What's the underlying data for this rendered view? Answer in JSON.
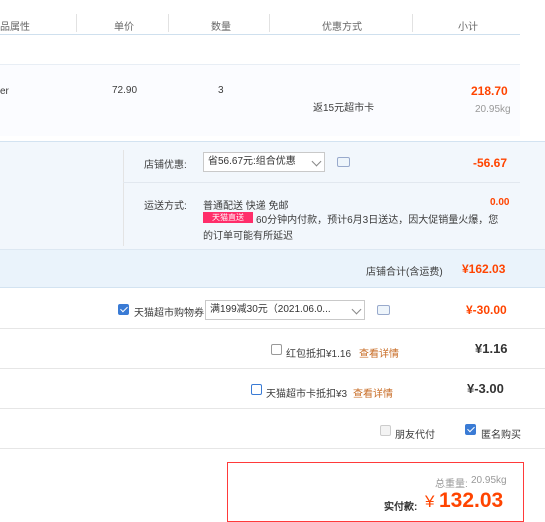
{
  "columns": {
    "attr": "品属性",
    "price": "单价",
    "qty": "数量",
    "discount": "优惠方式",
    "subtotal": "小计"
  },
  "item": {
    "attr_fragment": "er",
    "price": "72.90",
    "qty": "3",
    "discount_note": "返15元超市卡",
    "subtotal": "218.70",
    "weight": "20.95kg"
  },
  "store_discount": {
    "label": "店铺优惠:",
    "selected": "省56.67元:组合优惠",
    "amount": "-56.67"
  },
  "shipping": {
    "label": "运送方式:",
    "method": "普通配送 快递 免邮",
    "amount": "0.00",
    "tag": "天猫直送",
    "note_line1": "60分钟内付款，预计6月3日送达，因大促销量火爆，您",
    "note_line2": "的订单可能有所延迟"
  },
  "store_total": {
    "label": "店铺合计(含运费)",
    "amount": "¥162.03"
  },
  "coupon": {
    "label": "天猫超市购物券",
    "selected": "满199减30元（2021.06.0...",
    "amount": "¥-30.00"
  },
  "hongbao": {
    "label": "红包抵扣¥1.16",
    "link": "查看详情",
    "amount": "¥1.16"
  },
  "card": {
    "label": "天猫超市卡抵扣¥3",
    "link": "查看详情",
    "amount": "¥-3.00"
  },
  "options": {
    "friend_pay": "朋友代付",
    "anonymous": "匿名购买"
  },
  "summary": {
    "weight_label": "总重量:",
    "weight": "20.95kg",
    "pay_label": "实付款:",
    "currency": "¥",
    "total": "132.03"
  },
  "colors": {
    "accent_red": "#ff4400",
    "checkbox_blue": "#3a7bd5",
    "band": "#f2f7fc",
    "pay_border": "#ff3a3a"
  },
  "icons": [
    "chevron-down-icon",
    "chat-bubble-icon",
    "checkbox-icon"
  ]
}
